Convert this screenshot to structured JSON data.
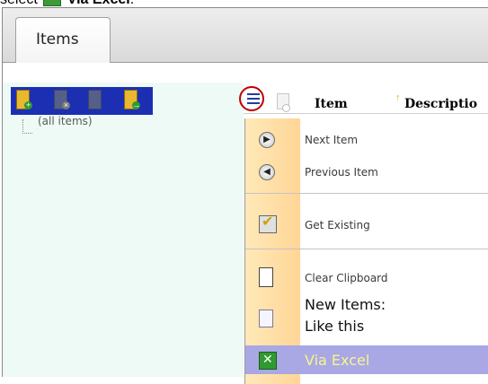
{
  "caption": {
    "prefix": "select",
    "bold_text": "Via Excel",
    "suffix": "."
  },
  "tabs": [
    {
      "label": "Items"
    }
  ],
  "tree": {
    "toolbar_icons": [
      "add-folder-icon",
      "delete-folder-icon",
      "folder-icon",
      "export-folder-icon"
    ],
    "root_label": "(all items)"
  },
  "grid": {
    "columns": [
      {
        "label": "Item"
      },
      {
        "label": "Descriptio"
      }
    ]
  },
  "menu": {
    "items": [
      {
        "label": "Next Item",
        "icon": "next-icon"
      },
      {
        "label": "Previous Item",
        "icon": "previous-icon"
      },
      {
        "label": "Get Existing",
        "icon": "checkbox-icon"
      },
      {
        "label": "Clear Clipboard",
        "icon": "clipboard-icon"
      },
      {
        "label": "New Items:",
        "sublabel": "Like this",
        "icon": "document-icon"
      },
      {
        "label": "Via Excel",
        "icon": "excel-icon",
        "selected": true
      }
    ]
  },
  "colors": {
    "selection": "#a9a7e4",
    "highlight_circle": "#c00000",
    "toolbar_bg": "#1c2fb2",
    "tree_bg": "#eefaf5",
    "gutter": "#ffd596"
  }
}
